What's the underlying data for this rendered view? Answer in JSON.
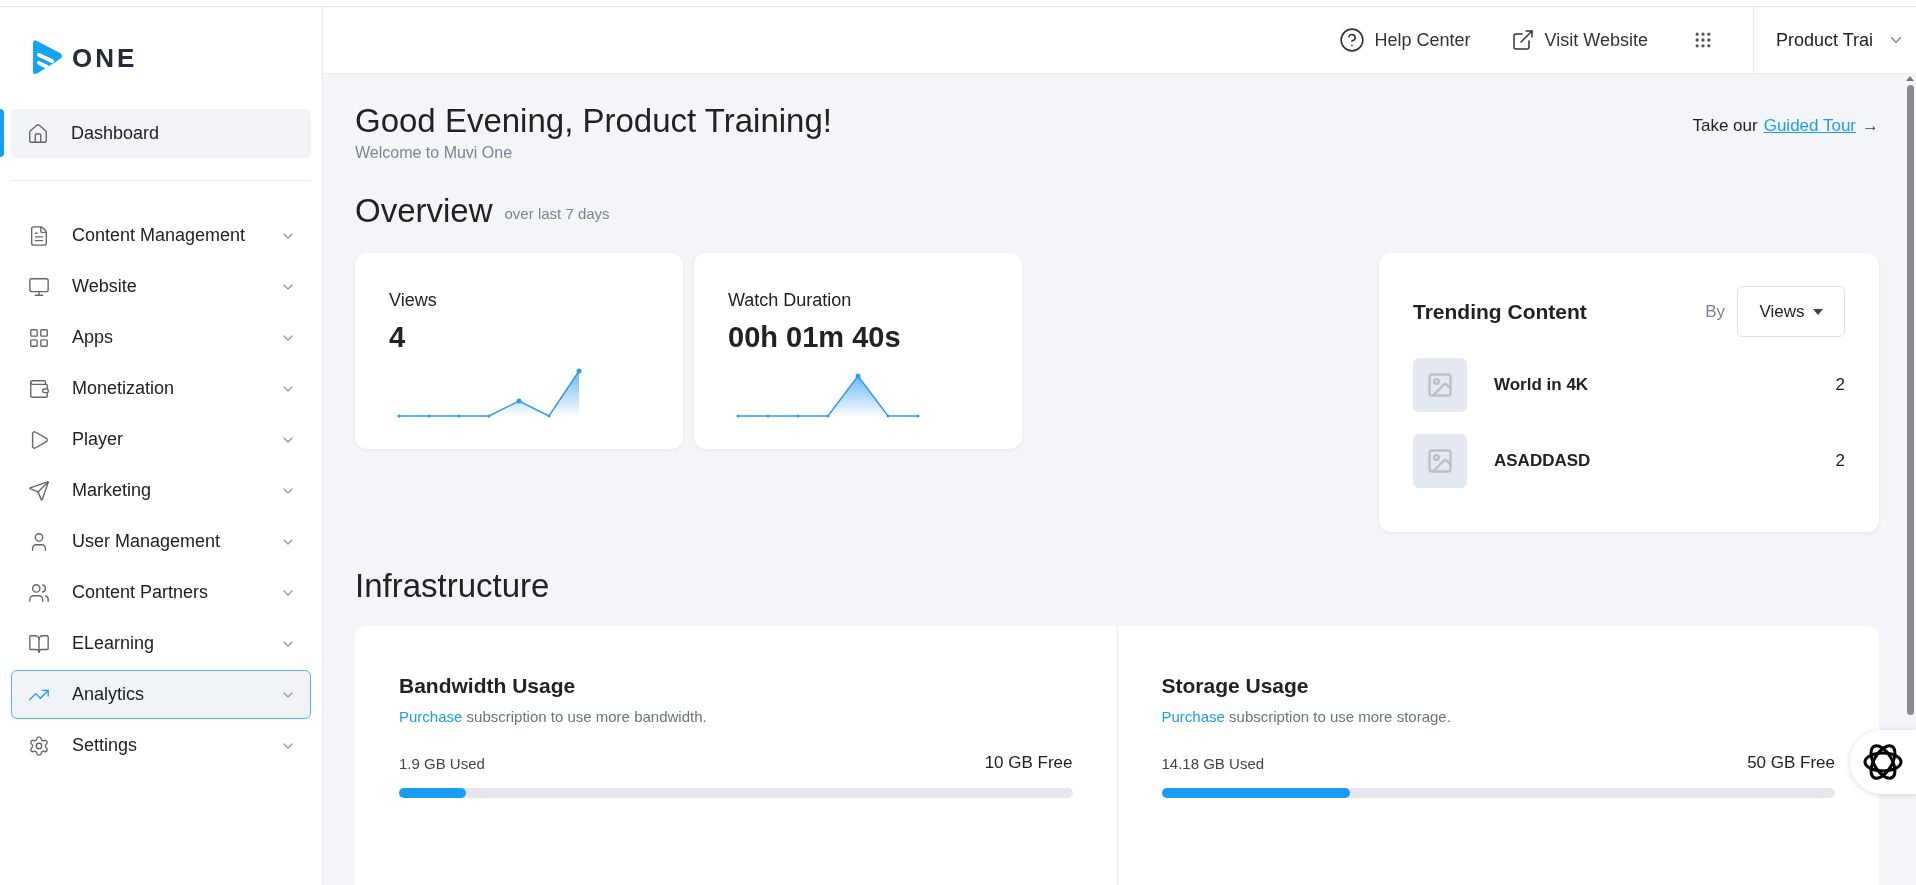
{
  "sidebar": {
    "logo_text": "ONE",
    "dashboard": {
      "label": "Dashboard",
      "selected": true
    },
    "items": [
      {
        "label": "Content Management",
        "hovered": false
      },
      {
        "label": "Website",
        "hovered": false
      },
      {
        "label": "Apps",
        "hovered": false
      },
      {
        "label": "Monetization",
        "hovered": false
      },
      {
        "label": "Player",
        "hovered": false
      },
      {
        "label": "Marketing",
        "hovered": false
      },
      {
        "label": "User Management",
        "hovered": false
      },
      {
        "label": "Content Partners",
        "hovered": false
      },
      {
        "label": "ELearning",
        "hovered": false
      },
      {
        "label": "Analytics",
        "hovered": true
      },
      {
        "label": "Settings",
        "hovered": false
      }
    ]
  },
  "header": {
    "help": "Help Center",
    "visit": "Visit Website",
    "account": "Product Trai"
  },
  "greeting": {
    "title": "Good Evening, Product Training!",
    "subtitle": "Welcome to Muvi One",
    "tour_prefix": "Take our",
    "tour_link": "Guided Tour",
    "tour_arrow": "→"
  },
  "overview": {
    "title": "Overview",
    "subtitle": "over last 7 days",
    "cards": [
      {
        "label": "Views",
        "value": "4",
        "kind": "rise"
      },
      {
        "label": "Watch Duration",
        "value": "00h 01m 40s",
        "kind": "peak"
      }
    ]
  },
  "trending": {
    "title": "Trending Content",
    "by": "By",
    "sort": "Views",
    "items": [
      {
        "title": "World in 4K",
        "count": "2"
      },
      {
        "title": "ASADDASD",
        "count": "2"
      }
    ]
  },
  "infrastructure": {
    "title": "Infrastructure",
    "panels": [
      {
        "title": "Bandwidth Usage",
        "link": "Purchase",
        "note": "subscription to use more bandwidth.",
        "used": "1.9 GB Used",
        "free": "10 GB Free",
        "level": 0.1
      },
      {
        "title": "Storage Usage",
        "link": "Purchase",
        "note": "subscription to use more storage.",
        "used": "14.18 GB Used",
        "free": "50 GB Free",
        "level": 0.28
      }
    ]
  }
}
